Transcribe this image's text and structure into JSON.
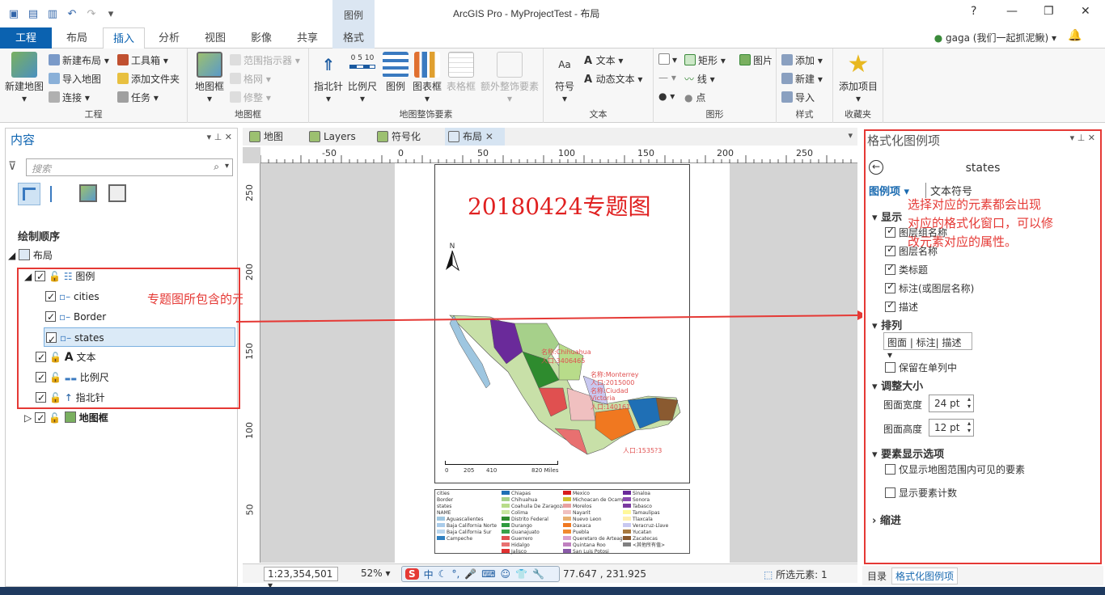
{
  "app": {
    "title": "ArcGIS Pro - MyProjectTest - 布局",
    "context_group": "图例"
  },
  "window_controls": {
    "help": "?",
    "minimize": "—",
    "restore": "❐",
    "close": "✕"
  },
  "user": {
    "name": "gaga (我们一起抓泥鳅)"
  },
  "tabs": [
    {
      "label": "工程"
    },
    {
      "label": "布局"
    },
    {
      "label": "插入"
    },
    {
      "label": "分析"
    },
    {
      "label": "视图"
    },
    {
      "label": "影像"
    },
    {
      "label": "共享"
    },
    {
      "label": "格式"
    }
  ],
  "ribbon": {
    "project": {
      "label": "工程",
      "new_map": "新建地图",
      "new_layout": "新建布局",
      "import_map": "导入地图",
      "connect": "连接",
      "toolbox": "工具箱",
      "add_folder": "添加文件夹",
      "task": "任务"
    },
    "mapframe": {
      "label": "地图框",
      "map_frame": "地图框",
      "range_indicator": "范围指示器",
      "grid": "格网",
      "trim": "修整"
    },
    "surround": {
      "label": "地图整饰要素",
      "north_arrow": "指北针",
      "scale_bar": "比例尺",
      "legend": "图例",
      "chart_frame": "图表框",
      "table_frame": "表格框",
      "extra": "额外整饰要素",
      "scale_digits": "0  5  10"
    },
    "text": {
      "label": "文本",
      "symbol": "符号",
      "text": "文本",
      "dynamic_text": "动态文本"
    },
    "graphics": {
      "label": "图形",
      "rect": "矩形",
      "picture": "图片",
      "line": "线",
      "point": "点"
    },
    "styles": {
      "label": "样式",
      "add": "添加",
      "new": "新建",
      "import": "导入"
    },
    "favorites": {
      "label": "收藏夹",
      "add_item": "添加项目"
    }
  },
  "contents": {
    "title": "内容",
    "search_placeholder": "搜索",
    "drawing_order": "绘制顺序",
    "root": "布局",
    "items": [
      {
        "label": "图例"
      },
      {
        "label": "cities"
      },
      {
        "label": "Border"
      },
      {
        "label": "states"
      },
      {
        "label": "文本"
      },
      {
        "label": "比例尺"
      },
      {
        "label": "指北针"
      },
      {
        "label": "地图框"
      }
    ]
  },
  "annotations": {
    "left": "专题图所包含的元素",
    "right_1": "选择对应的元素都会出现",
    "right_2": "对应的格式化窗口，可以修",
    "right_3": "改元素对应的属性。"
  },
  "doc_tabs": [
    {
      "label": "地图"
    },
    {
      "label": "Layers"
    },
    {
      "label": "符号化"
    },
    {
      "label": "布局"
    }
  ],
  "rulers": {
    "h": [
      "-50",
      "0",
      "50",
      "100",
      "150",
      "200",
      "250"
    ],
    "v": [
      "250",
      "200",
      "150",
      "100",
      "50"
    ]
  },
  "layout": {
    "title": "20180424专题图",
    "north": "N",
    "scale_labels": [
      "0",
      "205",
      "410",
      "820 Miles"
    ],
    "map_labels": [
      {
        "text": "名称:Chihuahua"
      },
      {
        "text": "人口:3406465"
      },
      {
        "text": "名称:Monterrey"
      },
      {
        "text": "人口:2015000"
      },
      {
        "text": "名称:Ciudad"
      },
      {
        "text": "Victoria"
      },
      {
        "text": "人口:140161"
      },
      {
        "text": "人口:1535?3"
      }
    ],
    "legend": {
      "col1": [
        "cities",
        "Border",
        "states",
        "NAME",
        "Aguascalientes",
        "Baja California Norte",
        "Baja California Sur",
        "Campeche"
      ],
      "col2": [
        "Chiapas",
        "Chihuahua",
        "Coahuila De Zaragoza",
        "Colima",
        "Distrito Federal",
        "Durango",
        "Guanajuato",
        "Guerrero",
        "Hidalgo",
        "Jalisco"
      ],
      "col3": [
        "Mexico",
        "Michoacan de Ocampo",
        "Morelos",
        "Nayarit",
        "Nuevo Leon",
        "Oaxaca",
        "Puebla",
        "Queretaro de Arteaga",
        "Quintana Roo",
        "San Luis Potosi"
      ],
      "col4": [
        "Sinaloa",
        "Sonora",
        "Tabasco",
        "Tamaulipas",
        "Tlaxcala",
        "Veracruz-Llave",
        "Yucatan",
        "Zacatecas",
        "<其他所有值>"
      ],
      "colors2": [
        "#1f6fb5",
        "#a6d08a",
        "#b8dc8a",
        "#c8e6a0",
        "#2e8b2e",
        "#2e9b3e",
        "#3aa24a",
        "#e05050",
        "#e87070",
        "#e03030"
      ],
      "colors3": [
        "#d81e1e",
        "#d0c030",
        "#e8a0a0",
        "#f0c0c0",
        "#e8b070",
        "#f07820",
        "#f08a30",
        "#d8a0d0",
        "#c080c0",
        "#8a5aa8"
      ],
      "colors4": [
        "#6a2a9a",
        "#8a4ab0",
        "#7a3aa0",
        "#fff89a",
        "#fff0b0",
        "#c8c8f0",
        "#a87a40",
        "#8a5a30",
        "#808080"
      ],
      "colors1": [
        "#9ec6e0",
        "#aaccea",
        "#bad6ee",
        "#2f7fbf"
      ]
    }
  },
  "status": {
    "scale": "1:23,354,501",
    "zoom": "52%",
    "coords": "77.647 , 231.925",
    "selected": "所选元素: 1"
  },
  "format_pane": {
    "title": "格式化图例项",
    "element": "states",
    "tab_legend_item": "图例项",
    "tab_text_symbol": "文本符号",
    "section_display": "显示",
    "display_opts": [
      "图层组名称",
      "图层名称",
      "类标题",
      "标注(或图层名称)",
      "描述"
    ],
    "section_arrange": "排列",
    "arrange_value": "图面 | 标注| 描述",
    "keep_single": "保留在单列中",
    "section_size": "调整大小",
    "patch_width_label": "图面宽度",
    "patch_width": "24 pt",
    "patch_height_label": "图面高度",
    "patch_height": "12 pt",
    "section_feature": "要素显示选项",
    "only_visible": "仅显示地图范围内可见的要素",
    "show_count": "显示要素计数",
    "section_indent": "缩进"
  },
  "bottom_tabs": {
    "catalog": "目录",
    "format": "格式化图例项"
  },
  "ime": {
    "lang": "中"
  }
}
